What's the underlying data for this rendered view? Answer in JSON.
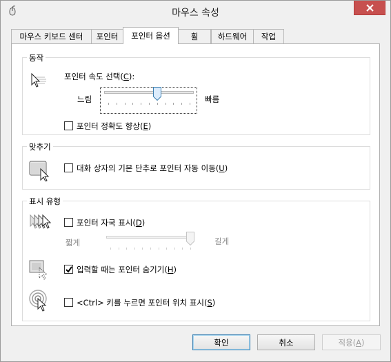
{
  "window": {
    "title": "마우스 속성",
    "close_icon": "close-icon"
  },
  "tabs": [
    {
      "label": "마우스 키보드 센터"
    },
    {
      "label": "포인터"
    },
    {
      "label": "포인터 옵션"
    },
    {
      "label": "휠"
    },
    {
      "label": "하드웨어"
    },
    {
      "label": "작업"
    }
  ],
  "motion": {
    "group_label": "동작",
    "speed_label": "포인터 속도 선택(",
    "speed_key": "C",
    "speed_tail": "):",
    "slow": "느림",
    "fast": "빠름",
    "speed_value": 0.6,
    "precision_label": "포인터 정확도 향상(",
    "precision_key": "E",
    "precision_tail": ")",
    "precision_checked": false
  },
  "snap": {
    "group_label": "맞추기",
    "snap_label": "대화 상자의 기본 단추로 포인터 자동 이동(",
    "snap_key": "U",
    "snap_tail": ")",
    "snap_checked": false
  },
  "visibility": {
    "group_label": "표시 유형",
    "trails_label": "포인터 자국 표시(",
    "trails_key": "D",
    "trails_tail": ")",
    "trails_checked": false,
    "short": "짧게",
    "long": "길게",
    "trails_value": 1.0,
    "hide_label": "입력할 때는 포인터 숨기기(",
    "hide_key": "H",
    "hide_tail": ")",
    "hide_checked": true,
    "ctrl_label": "<Ctrl> 키를 누르면 포인터 위치 표시(",
    "ctrl_key": "S",
    "ctrl_tail": ")",
    "ctrl_checked": false
  },
  "buttons": {
    "ok": "확인",
    "cancel": "취소",
    "apply": "적용(",
    "apply_key": "A",
    "apply_tail": ")"
  }
}
